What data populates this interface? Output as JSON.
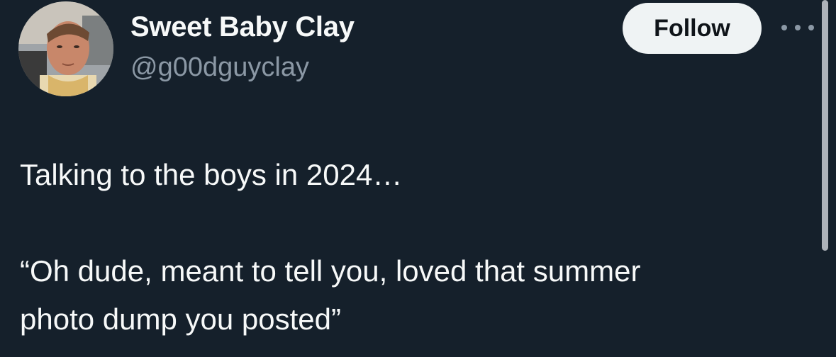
{
  "author": {
    "display_name": "Sweet Baby Clay",
    "handle": "@g00dguyclay"
  },
  "actions": {
    "follow_label": "Follow",
    "more_icon": "more-horizontal-icon"
  },
  "tweet": {
    "line1": "Talking to the boys in 2024…",
    "line2": "“Oh dude, meant to tell you, loved that summer",
    "line3": "photo dump you posted”"
  },
  "colors": {
    "background": "#15202b",
    "text": "#f7f9f9",
    "secondary_text": "#8b98a5",
    "button_bg": "#eff3f4",
    "button_text": "#0f1419"
  }
}
